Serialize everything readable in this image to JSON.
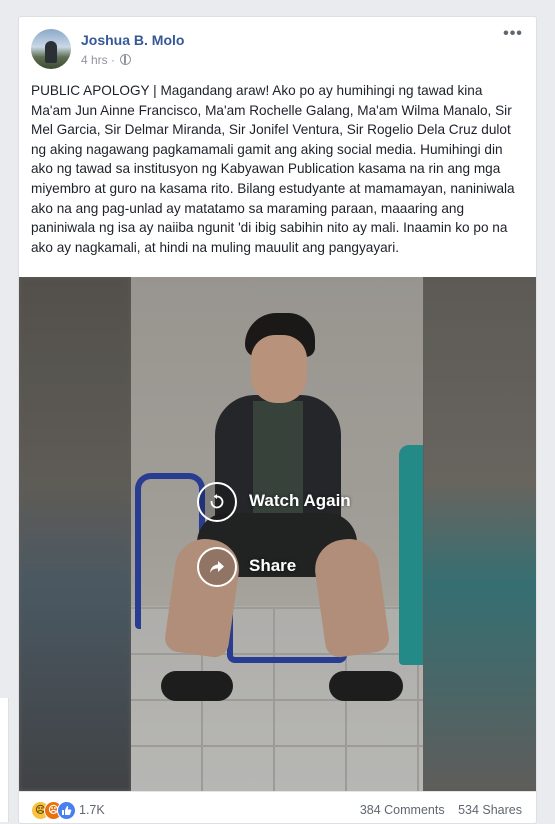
{
  "post": {
    "author": "Joshua B. Molo",
    "time": "4 hrs",
    "separator": "·",
    "more_label": "•••",
    "text": "PUBLIC APOLOGY | Magandang araw! Ako po ay humihingi ng tawad kina Ma'am Jun Ainne Francisco, Ma'am Rochelle Galang, Ma'am Wilma Manalo, Sir Mel Garcia, Sir Delmar Miranda, Sir Jonifel Ventura, Sir Rogelio Dela Cruz dulot ng aking nagawang pagkamamali gamit ang aking social media. Humihingi din ako ng tawad sa institusyon ng Kabyawan Publication kasama na rin ang mga miyembro at guro na kasama rito. Bilang estudyante at mamamayan, naniniwala ako na ang pag-unlad ay matatamo sa maraming paraan, maaaring ang paniniwala ng isa ay naiiba ngunit 'di ibig sabihin nito ay mali. Inaamin ko po na ako ay nagkamali, at hindi na muling mauulit ang pangyayari."
  },
  "video": {
    "watch_again_label": "Watch Again",
    "share_label": "Share",
    "replay_icon": "replay-icon",
    "share_icon": "share-arrow-icon"
  },
  "footer": {
    "reactions": [
      "sad",
      "angry",
      "like"
    ],
    "reaction_count": "1.7K",
    "comments": "384 Comments",
    "shares": "534 Shares"
  },
  "colors": {
    "author_link": "#365899",
    "page_bg": "#e9ebee",
    "card_bg": "#ffffff",
    "meta_text": "#90949c"
  }
}
